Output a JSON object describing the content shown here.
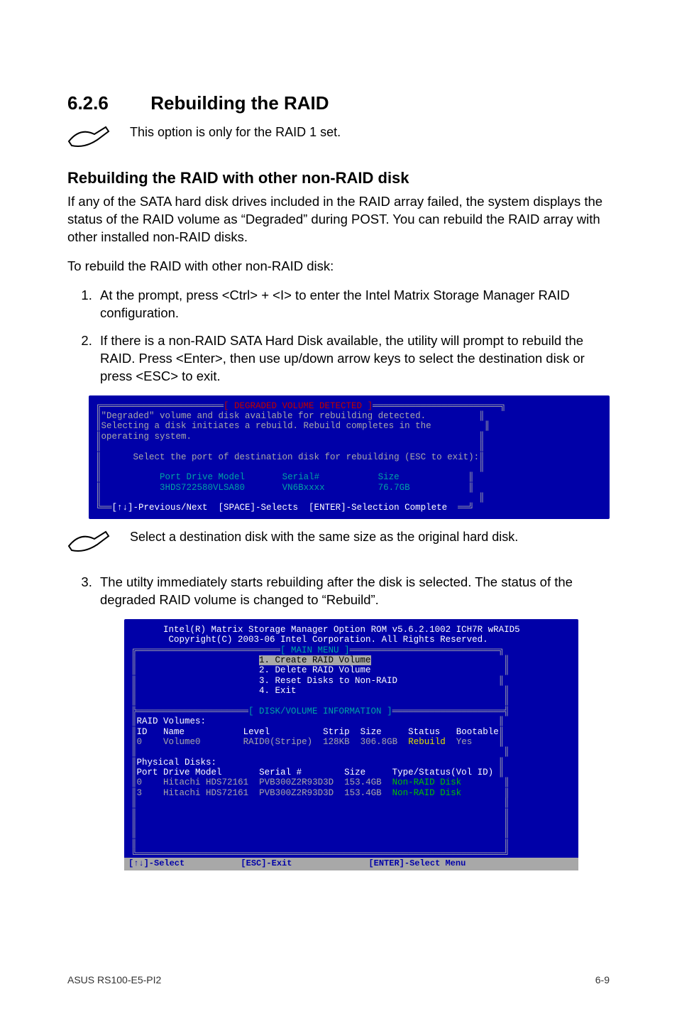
{
  "section": {
    "number": "6.2.6",
    "title": "Rebuilding the RAID"
  },
  "note1": "This option is only for the RAID 1 set.",
  "subhead1": "Rebuilding the RAID with other non-RAID disk",
  "para1": "If any of the SATA hard disk drives included in the RAID array failed, the system displays the status of the RAID volume as “Degraded” during POST. You can rebuild the RAID array with other installed non-RAID disks.",
  "para2": "To rebuild the RAID with other non-RAID disk:",
  "steps": [
    "At the prompt, press <Ctrl> + <I> to enter the Intel Matrix Storage Manager RAID configuration.",
    "If there is a non-RAID SATA Hard Disk available, the utility will prompt to rebuild the RAID. Press <Enter>, then use up/down arrow keys to select  the destination disk or press <ESC> to exit."
  ],
  "bios1": {
    "title": "[ DEGRADED VOLUME DETECTED ]",
    "line1": "\"Degraded\" volume and disk available for rebuilding detected.",
    "line2": "Selecting a disk initiates a rebuild. Rebuild completes in the",
    "line3": "operating system.",
    "line4": "Select the port of destination disk for rebuilding (ESC to exit):",
    "hdr_port": "Port",
    "hdr_model": "Drive Model",
    "hdr_serial": "Serial#",
    "hdr_size": "Size",
    "row_model": "3HDS722580VLSA80",
    "row_serial": "VN6Bxxxx",
    "row_size": "76.7GB",
    "footer": "[↑↓]-Previous/Next  [SPACE]-Selects  [ENTER]-Selection Complete"
  },
  "note2": "Select a destination disk with the same size as the original hard disk.",
  "step3": "The utilty immediately starts rebuilding after the disk is selected. The status of the degraded RAID volume is changed to “Rebuild”.",
  "bios2": {
    "hdr1": "Intel(R) Matrix Storage Manager Option ROM v5.6.2.1002 ICH7R wRAID5",
    "hdr2": "Copyright(C) 2003-06 Intel Corporation. All Rights Reserved.",
    "menu_title": "[ MAIN MENU ]",
    "m1": "1. Create RAID Volume",
    "m2": "2. Delete RAID Volume",
    "m3": "3. Reset Disks to Non-RAID",
    "m4": "4. Exit",
    "info_title": "[ DISK/VOLUME INFORMATION ]",
    "volumes_label": "RAID Volumes:",
    "vol_hdr": {
      "id": "ID",
      "name": "Name",
      "level": "Level",
      "strip": "Strip",
      "size": "Size",
      "status": "Status",
      "bootable": "Bootable"
    },
    "vol_row": {
      "id": "0",
      "name": "Volume0",
      "level": "RAID0(Stripe)",
      "strip": "128KB",
      "size": "306.8GB",
      "status": "Rebuild",
      "bootable": "Yes"
    },
    "phys_label": "Physical Disks:",
    "phys_hdr": {
      "port": "Port",
      "model": "Drive Model",
      "serial": "Serial #",
      "size": "Size",
      "type": "Type/Status(Vol ID)"
    },
    "phys_rows": [
      {
        "port": "0",
        "model": "Hitachi HDS72161",
        "serial": "PVB300Z2R93D3D",
        "size": "153.4GB",
        "type": "Non-RAID Disk"
      },
      {
        "port": "3",
        "model": "Hitachi HDS72161",
        "serial": "PVB300Z2R93D3D",
        "size": "153.4GB",
        "type": "Non-RAID Disk"
      }
    ],
    "footer": "[↑↓]-Select           [ESC]-Exit               [ENTER]-Select Menu"
  },
  "footer": {
    "model": "ASUS RS100-E5-PI2",
    "pg": "6-9"
  }
}
